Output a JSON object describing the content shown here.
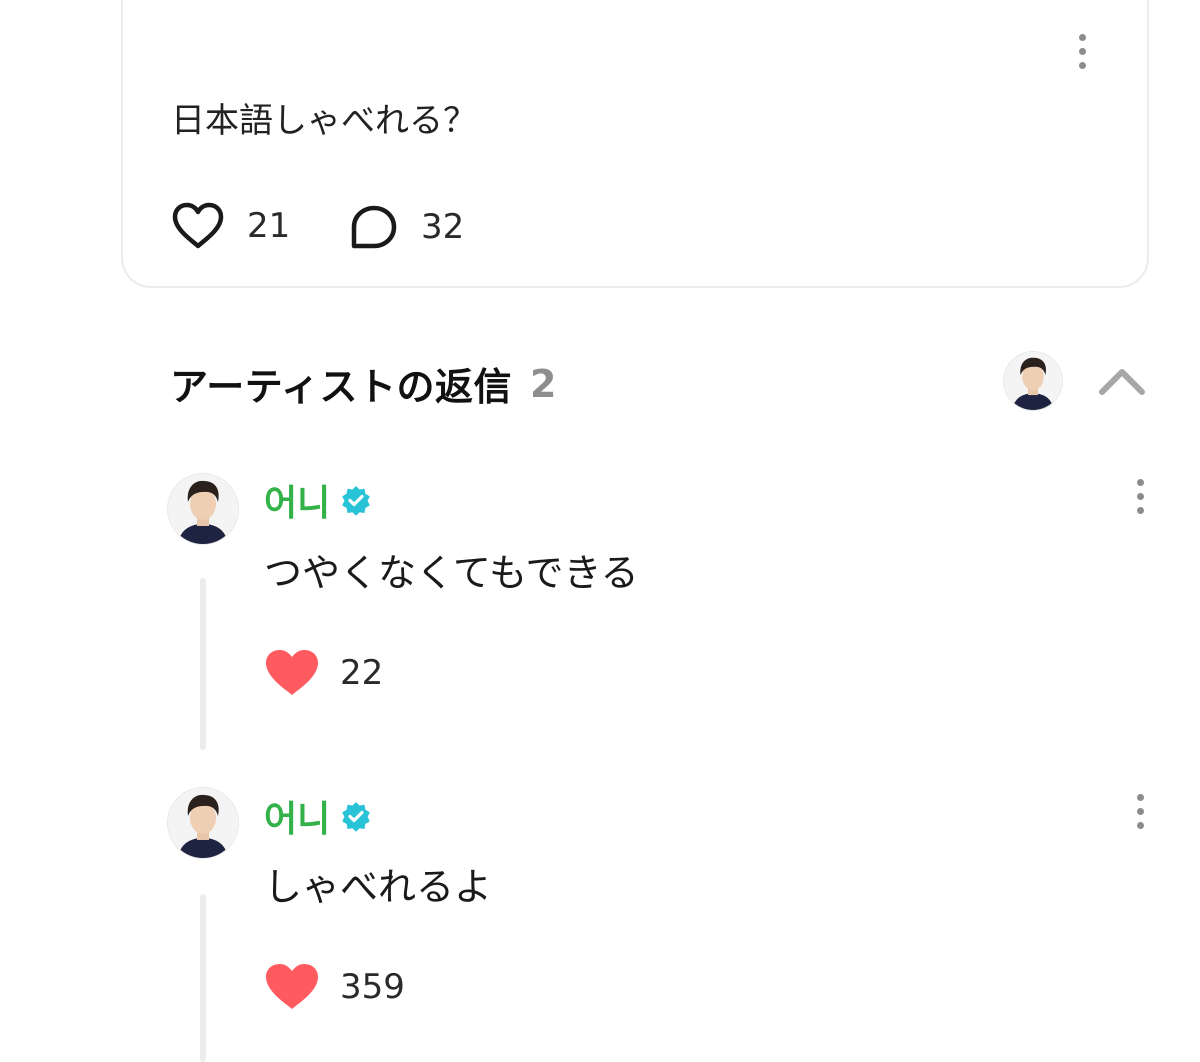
{
  "post": {
    "text": "日本語しゃべれる？",
    "likes": "21",
    "comments": "32"
  },
  "replies_section": {
    "title": "アーティストの返信",
    "count": "2"
  },
  "replies": [
    {
      "author": "어니",
      "text": "つやくなくてもできる",
      "likes": "22"
    },
    {
      "author": "어니",
      "text": "しゃべれるよ",
      "likes": "359"
    }
  ],
  "colors": {
    "author": "#34b24a",
    "verified": "#29c3d8",
    "liked_heart": "#ff5a5f"
  },
  "icons": [
    "more-vertical-icon",
    "heart-outline-icon",
    "comment-bubble-icon",
    "chevron-up-icon",
    "verified-badge-icon",
    "heart-filled-icon"
  ]
}
